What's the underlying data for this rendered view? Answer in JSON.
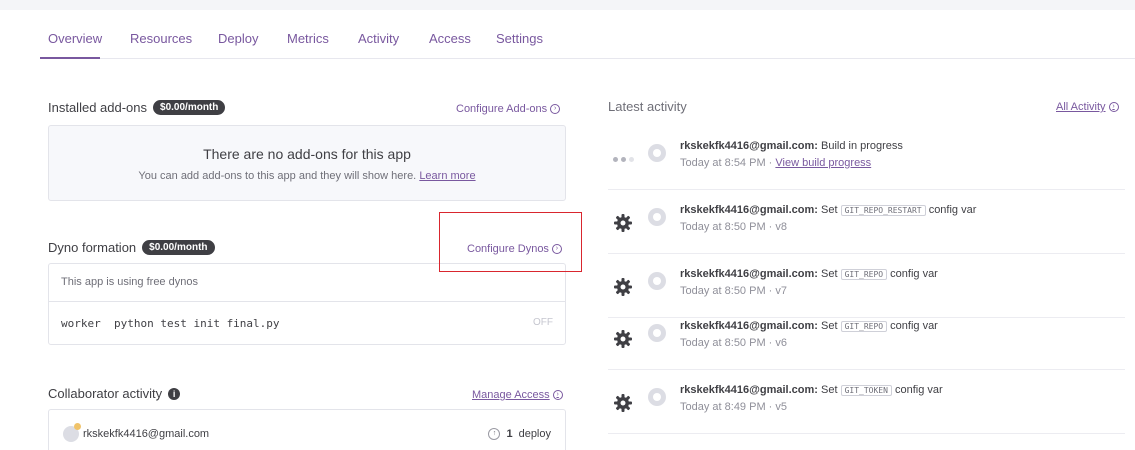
{
  "tabs": [
    "Overview",
    "Resources",
    "Deploy",
    "Metrics",
    "Activity",
    "Access",
    "Settings"
  ],
  "addons": {
    "title": "Installed add-ons",
    "price": "$0.00/month",
    "configure_link": "Configure Add-ons",
    "empty_title": "There are no add-ons for this app",
    "empty_sub": "You can add add-ons to this app and they will show here.",
    "learn_more": "Learn more"
  },
  "dynos": {
    "title": "Dyno formation",
    "price": "$0.00/month",
    "configure_link": "Configure Dynos",
    "free_note": "This app is using free dynos",
    "process_command": "worker  python test init final.py",
    "process_state": "OFF"
  },
  "collaborators": {
    "title": "Collaborator activity",
    "manage_link": "Manage Access",
    "user": "rkskekfk4416@gmail.com",
    "deploy_count": "1",
    "deploy_label": "deploy"
  },
  "activity": {
    "title": "Latest activity",
    "all_link": "All Activity",
    "items": [
      {
        "user": "rkskekfk4416@gmail.com:",
        "action": "Build in progress",
        "chip": "",
        "suffix": "",
        "time": "Today at 8:54 PM",
        "link": "View build progress",
        "version": ""
      },
      {
        "user": "rkskekfk4416@gmail.com:",
        "action": "Set",
        "chip": "GIT_REPO_RESTART",
        "suffix": "config var",
        "time": "Today at 8:50 PM",
        "link": "",
        "version": "v8"
      },
      {
        "user": "rkskekfk4416@gmail.com:",
        "action": "Set",
        "chip": "GIT_REPO",
        "suffix": "config var",
        "time": "Today at 8:50 PM",
        "link": "",
        "version": "v7"
      },
      {
        "user": "rkskekfk4416@gmail.com:",
        "action": "Set",
        "chip": "GIT_REPO",
        "suffix": "config var",
        "time": "Today at 8:50 PM",
        "link": "",
        "version": "v6"
      },
      {
        "user": "rkskekfk4416@gmail.com:",
        "action": "Set",
        "chip": "GIT_TOKEN",
        "suffix": "config var",
        "time": "Today at 8:49 PM",
        "link": "",
        "version": "v5"
      }
    ]
  },
  "colors": {
    "accent": "#79589f",
    "highlight": "#d9262e"
  }
}
